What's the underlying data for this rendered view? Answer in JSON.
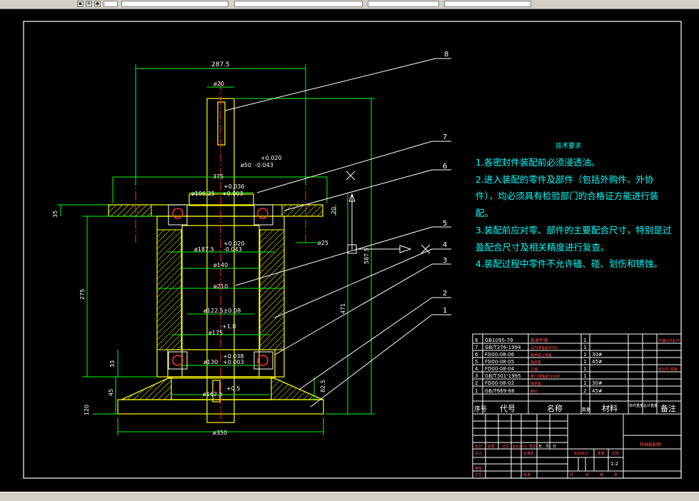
{
  "drawing": {
    "dimensions": {
      "d287": "287.5",
      "d20": "ø20",
      "tol1_upper": "+0.020",
      "tol1_label": "ø50",
      "tol1_lower": "-0.043",
      "d375": "375",
      "tol2_upper": "+0.036",
      "tol2_label": "ø106.25",
      "tol2_lower": "+0.003",
      "d35": "35",
      "d20b": "20",
      "tol3_upper": "+0.020",
      "tol3_label": "ø187.5",
      "tol3_lower": "-0.043",
      "d25": "ø25",
      "d140": "ø140",
      "d210": "ø210",
      "d275": "275",
      "d587": "587.5",
      "d471": "471",
      "d122": "ø122.5±0.08",
      "d10": "+1.0",
      "d175": "ø175",
      "tol4_upper": "+0.038",
      "tol4_label": "ø130",
      "tol4_lower": "+0.003",
      "d33": "33",
      "d05": "+0.5",
      "d162": "ø162.5",
      "d45": "45",
      "d825": "82.5",
      "d120": "120",
      "d350": "ø350"
    },
    "balloons": [
      "8",
      "7",
      "6",
      "5",
      "4",
      "3",
      "2",
      "1"
    ]
  },
  "tech_requirements": {
    "title": "技术要求",
    "items": [
      "1.各密封件装配前必须浸透油。",
      "2.进入装配的零件及部件（包括外购件、外协",
      "件），均必须具有检验部门的合格证方能进行装",
      "配。",
      "3.装配前应对零、部件的主要配合尺寸，特别是过",
      "盈配合尺寸及相关精度进行复查。",
      "4.装配过程中零件不允许磕、碰、划伤和锈蚀。"
    ]
  },
  "bom": {
    "rows": [
      {
        "no": "8",
        "code": "GB1095-79",
        "name": "普通平键",
        "qty": "1",
        "mat": "",
        "note": "",
        "remark": "平键b20ф70"
      },
      {
        "no": "7",
        "code": "GB/T276-1994",
        "name": "深沟球轴承6002",
        "qty": "1",
        "mat": "",
        "note": "",
        "remark": ""
      },
      {
        "no": "6",
        "code": "FD00-08-06",
        "name": "轴承座上端盖",
        "qty": "1",
        "mat": "30#",
        "note": "",
        "remark": ""
      },
      {
        "no": "5",
        "code": "FD00-08-05",
        "name": "轴承套",
        "qty": "1",
        "mat": "45#",
        "note": "",
        "remark": ""
      },
      {
        "no": "4",
        "code": "FD00-08-04",
        "name": "立轴",
        "qty": "1",
        "mat": "",
        "note": "",
        "remark": "组合件·焊接"
      },
      {
        "no": "3",
        "code": "GB/T301-1995",
        "name": "推力球轴承51008",
        "qty": "1",
        "mat": "",
        "note": "",
        "remark": ""
      },
      {
        "no": "2",
        "code": "FD00-08-02",
        "name": "轴承座",
        "qty": "1",
        "mat": "30#",
        "note": "",
        "remark": ""
      },
      {
        "no": "1",
        "code": "GB/T669-86",
        "name": "螺钉",
        "qty": "2",
        "mat": "45#",
        "note": "",
        "remark": ""
      }
    ],
    "headers": {
      "no": "序号",
      "code": "代号",
      "name": "名称",
      "qty": "数量",
      "mat": "材料",
      "weight": "单件重量",
      "total": "总计重量",
      "remark": "备注"
    }
  },
  "title_block": {
    "drawing_name": "转轴装配图",
    "scale": "1:2",
    "labels": {
      "mark": "标记",
      "count": "处数",
      "zone": "分区",
      "change_doc": "更改文件号",
      "sign": "签名",
      "date": "年、月、日",
      "design": "设计",
      "standard": "标准化",
      "stage_mark": "阶段标记",
      "weight": "重量",
      "ratio": "比例",
      "review": "审核",
      "process": "工艺",
      "approve": "批准",
      "total_sheets": "共",
      "sheet": "张",
      "page": "第"
    }
  }
}
